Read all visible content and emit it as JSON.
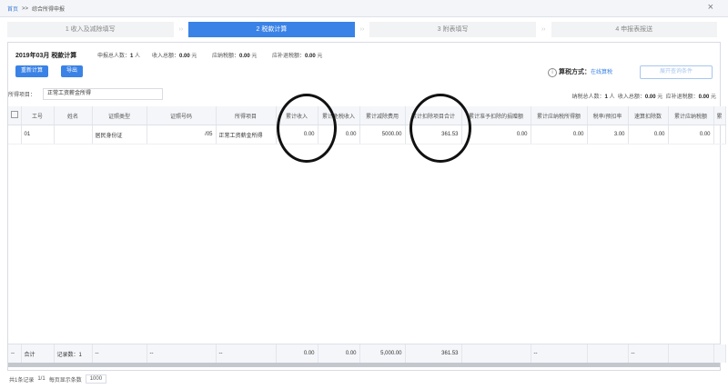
{
  "breadcrumb": {
    "home": "首页",
    "separator": ">>",
    "current": "综合所得申报"
  },
  "steps": [
    {
      "label": "1 收入及减除填写",
      "active": false
    },
    {
      "label": "2 税款计算",
      "active": true
    },
    {
      "label": "3 附表填写",
      "active": false
    },
    {
      "label": "4 申报表报送",
      "active": false
    }
  ],
  "step_arrow": "››",
  "summary": {
    "period": "2019年03月",
    "period_label": "税款计算",
    "declarants_label": "申报总人数：",
    "declarants_value": "1",
    "declarants_unit": "人",
    "income_label": "收入总额：",
    "income_value": "0.00",
    "income_unit": "元",
    "tax_payable_label": "应纳税额：",
    "tax_payable_value": "0.00",
    "tax_payable_unit": "元",
    "refund_label": "应补退税额：",
    "refund_value": "0.00",
    "refund_unit": "元"
  },
  "buttons": {
    "recalc": "重新计算",
    "export": "导出",
    "open_query": "展开查询条件"
  },
  "tax_method": {
    "label": "算税方式：",
    "value": "在线算税"
  },
  "filter": {
    "label": "所得项目：",
    "value": "正常工资薪金所得"
  },
  "right_stats": {
    "taxpayers_label": "纳税总人数：",
    "taxpayers_value": "1",
    "taxpayers_unit": "人",
    "income_label": "收入总额：",
    "income_value": "0.00",
    "income_unit": "元",
    "refund_label": "应补退税额：",
    "refund_value": "0.00",
    "refund_unit": "元"
  },
  "table": {
    "headers": [
      "工号",
      "姓名",
      "证照类型",
      "证照号码",
      "所得项目",
      "累计收入",
      "累计免税收入",
      "累计减除费用",
      "累计扣除项目合计",
      "累计准予扣除的捐赠额",
      "累计应纳税所得额",
      "税率/预扣率",
      "速算扣除数",
      "累计应纳税额",
      "累"
    ],
    "rows": [
      [
        "01",
        "",
        "居民身份证",
        "",
        "正常工资薪金所得",
        "0.00",
        "0.00",
        "5000.00",
        "361.53",
        "0.00",
        "0.00",
        "3.00",
        "0.00",
        "0.00",
        ""
      ]
    ],
    "id_suffix": "/05",
    "footer": [
      "--",
      "合计",
      "记录数：1",
      "--",
      "--",
      "--",
      "0.00",
      "0.00",
      "5,000.00",
      "361.53",
      "",
      "--",
      "",
      "--",
      ""
    ]
  },
  "pager": {
    "total": "共1条记录",
    "pages": "1/1",
    "page_size_label": "每页显示条数",
    "page_size": "1000"
  },
  "annotation_color": "#111111"
}
